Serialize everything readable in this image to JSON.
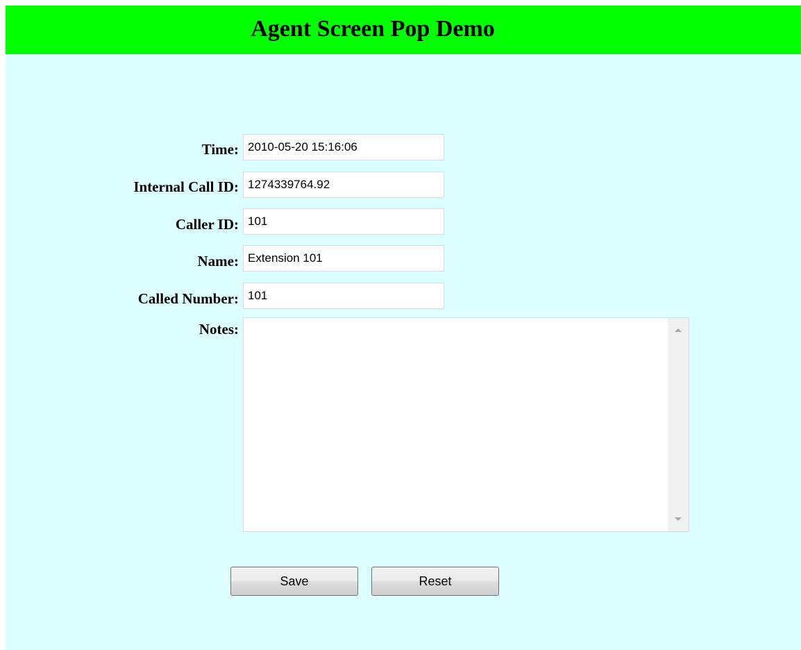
{
  "header": {
    "title": "Agent Screen Pop Demo"
  },
  "form": {
    "time": {
      "label": "Time:",
      "value": "2010-05-20 15:16:06"
    },
    "internal_call_id": {
      "label": "Internal Call ID:",
      "value": "1274339764.92"
    },
    "caller_id": {
      "label": "Caller ID:",
      "value": "101"
    },
    "name": {
      "label": "Name:",
      "value": "Extension 101"
    },
    "called_number": {
      "label": "Called Number:",
      "value": "101"
    },
    "notes": {
      "label": "Notes:",
      "value": ""
    }
  },
  "buttons": {
    "save_label": "Save",
    "reset_label": "Reset"
  },
  "colors": {
    "header_background": "#00ff00",
    "page_background": "#dcffff"
  }
}
